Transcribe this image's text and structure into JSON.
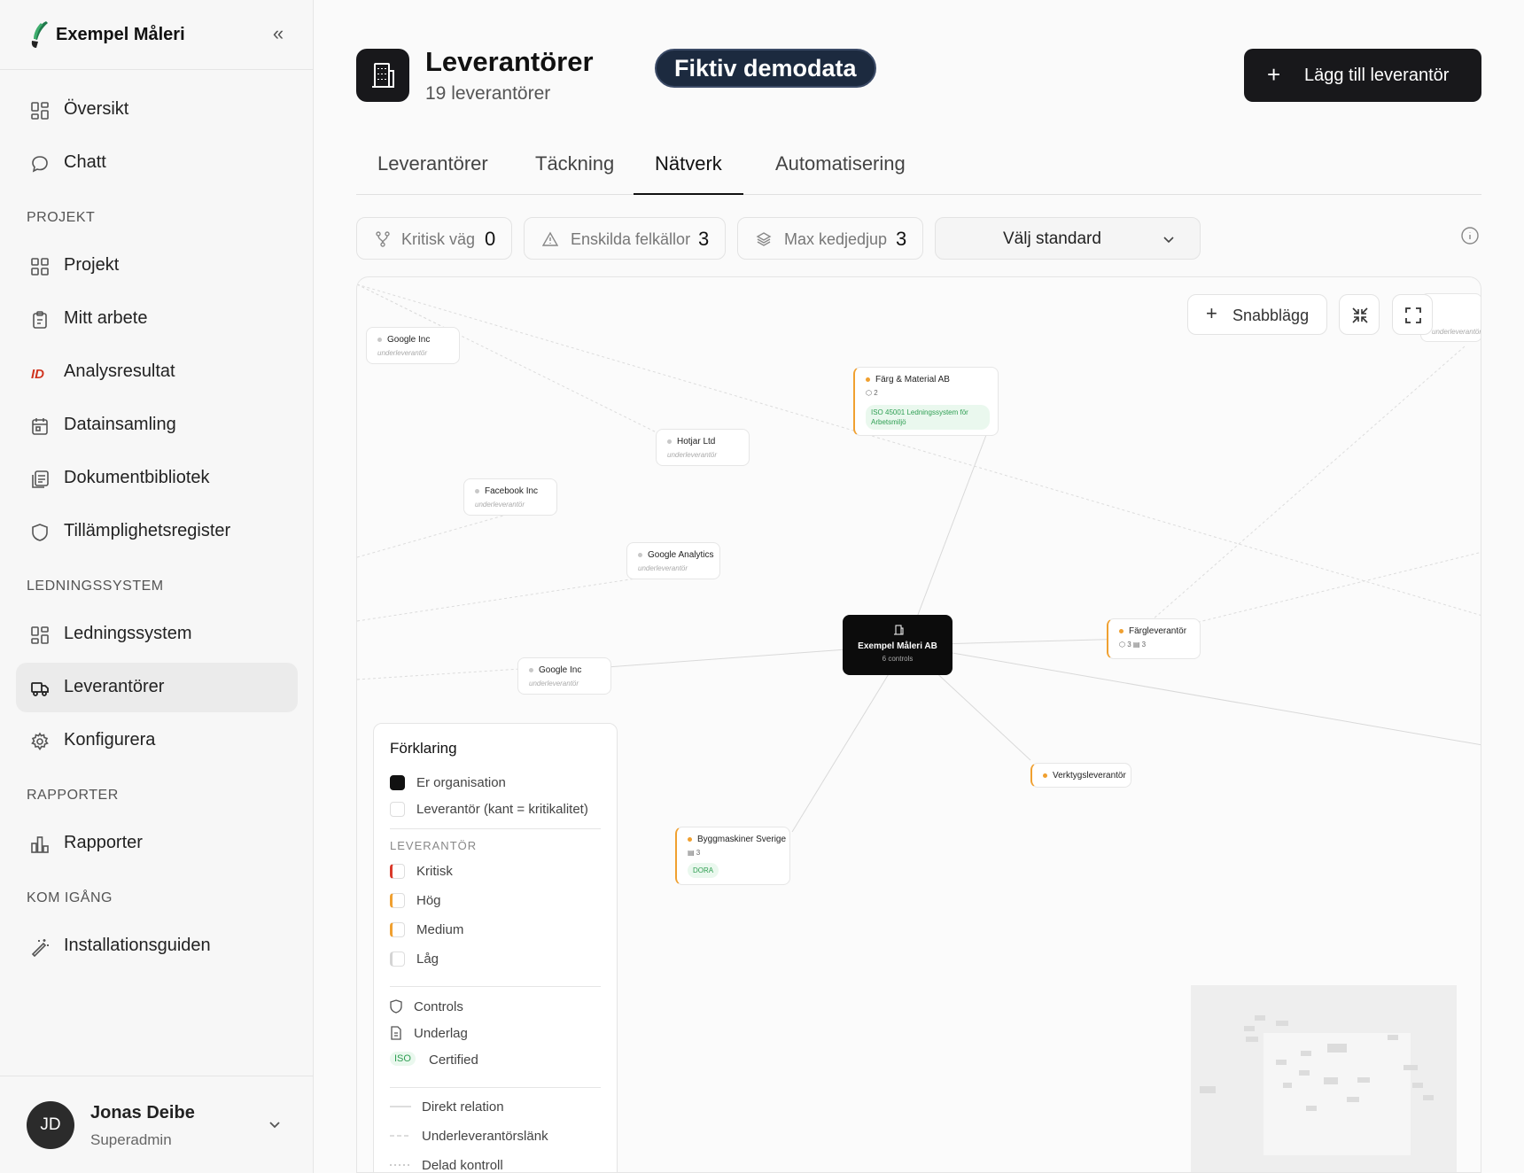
{
  "app": {
    "title": "Exempel Måleri"
  },
  "sidebar": {
    "top_items": [
      {
        "label": "Översikt",
        "icon": "grid-icon"
      },
      {
        "label": "Chatt",
        "icon": "chat-icon"
      }
    ],
    "sections": [
      {
        "title": "PROJEKT",
        "items": [
          {
            "label": "Projekt",
            "icon": "grid-icon"
          },
          {
            "label": "Mitt arbete",
            "icon": "clipboard-icon"
          },
          {
            "label": "Analysresultat",
            "icon": "id-icon"
          },
          {
            "label": "Datainsamling",
            "icon": "calendar-icon"
          },
          {
            "label": "Dokumentbibliotek",
            "icon": "library-icon"
          },
          {
            "label": "Tillämplighetsregister",
            "icon": "shield-icon"
          }
        ]
      },
      {
        "title": "LEDNINGSSYSTEM",
        "items": [
          {
            "label": "Ledningssystem",
            "icon": "grid-icon"
          },
          {
            "label": "Leverantörer",
            "icon": "truck-icon",
            "active": true
          },
          {
            "label": "Konfigurera",
            "icon": "gear-icon"
          }
        ]
      },
      {
        "title": "RAPPORTER",
        "items": [
          {
            "label": "Rapporter",
            "icon": "bar-chart-icon"
          }
        ]
      },
      {
        "title": "KOM IGÅNG",
        "items": [
          {
            "label": "Installationsguiden",
            "icon": "wand-icon"
          }
        ]
      }
    ],
    "user": {
      "initials": "JD",
      "name": "Jonas Deibe",
      "role": "Superadmin"
    }
  },
  "header": {
    "title": "Leverantörer",
    "subtitle": "19 leverantörer",
    "badge": "Fiktiv demodata",
    "add_button": "Lägg till leverantör"
  },
  "tabs": [
    {
      "label": "Leverantörer"
    },
    {
      "label": "Täckning"
    },
    {
      "label": "Nätverk",
      "active": true
    },
    {
      "label": "Automatisering"
    }
  ],
  "stats": {
    "critical_path": {
      "label": "Kritisk väg",
      "value": "0"
    },
    "single_points": {
      "label": "Enskilda felkällor",
      "value": "3"
    },
    "max_depth": {
      "label": "Max kedjedjup",
      "value": "3"
    },
    "standard_select": "Välj standard"
  },
  "canvas": {
    "quick_add": "Snabblägg",
    "org_node": {
      "name": "Exempel Måleri AB",
      "sub": "6 controls"
    },
    "nodes": [
      {
        "name": "Google Inc",
        "sub": "underleverantör"
      },
      {
        "name": "Hotjar Ltd",
        "sub": "underleverantör"
      },
      {
        "name": "Facebook Inc",
        "sub": "underleverantör"
      },
      {
        "name": "Google Analytics",
        "sub": "underleverantör"
      },
      {
        "name": "Google Inc",
        "sub": "underleverantör"
      },
      {
        "name": "Färg & Material AB",
        "meta": "⬡ 2",
        "cert": "ISO 45001 Ledningssystem för Arbetsmiljö"
      },
      {
        "name": "Färgleverantör",
        "meta": "⬡ 3  ▤ 3"
      },
      {
        "name": "Verktygsleverantör"
      },
      {
        "name": "Byggmaskiner Sverige",
        "meta": "▤ 3",
        "cert": "DORA"
      },
      {
        "name": "",
        "sub": "underleverantör"
      }
    ],
    "legend": {
      "title": "Förklaring",
      "org": "Er organisation",
      "supplier": "Leverantör (kant = kritikalitet)",
      "caption": "LEVERANTÖR",
      "levels": [
        {
          "label": "Kritisk",
          "color": "#d93a2b"
        },
        {
          "label": "Hög",
          "color": "#f0a030"
        },
        {
          "label": "Medium",
          "color": "#f0a030"
        },
        {
          "label": "Låg",
          "color": "#d4d4d4"
        }
      ],
      "controls": "Controls",
      "evidence": "Underlag",
      "cert_tag": "ISO",
      "certified": "Certified",
      "direct": "Direkt relation",
      "sub_link": "Underleverantörslänk",
      "shared": "Delad kontroll"
    }
  }
}
